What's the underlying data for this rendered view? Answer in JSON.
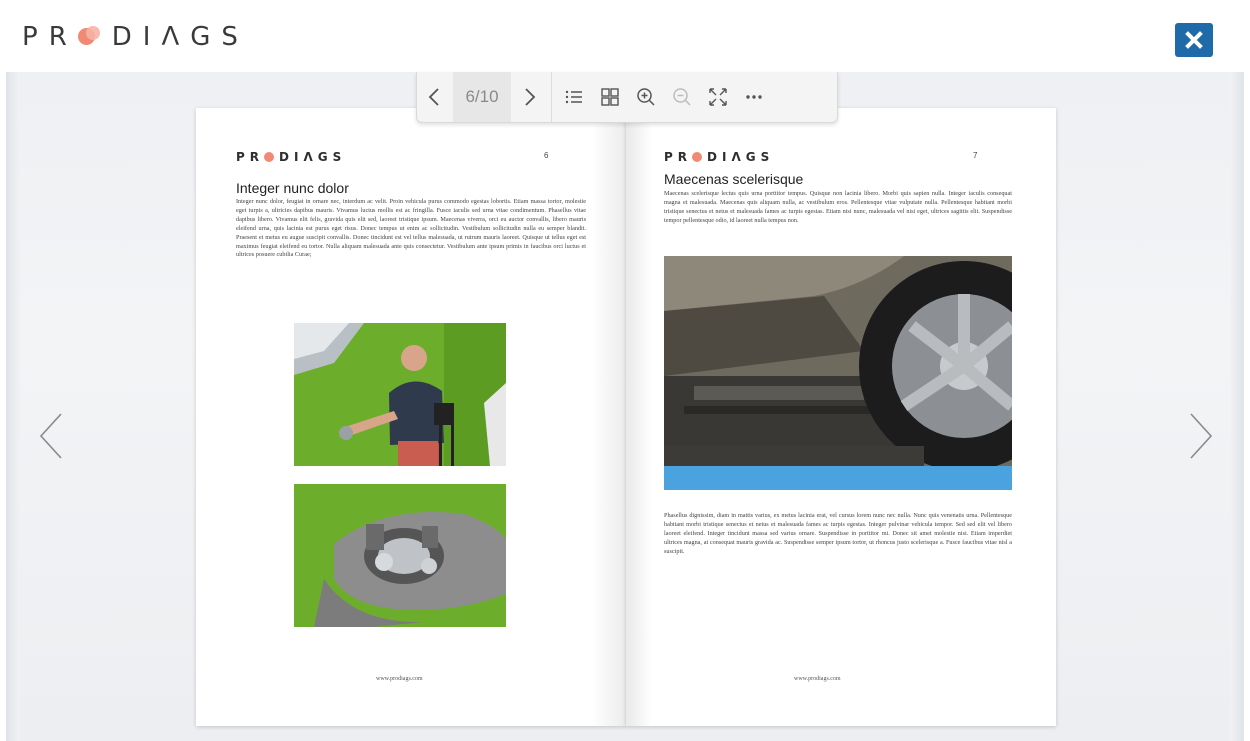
{
  "brand": {
    "logo_text": "PR DIAGS"
  },
  "toolbar": {
    "page_indicator": "6/10",
    "icons": [
      "chevron-left-icon",
      "chevron-right-icon",
      "list-icon",
      "grid-icon",
      "zoom-in-icon",
      "zoom-out-icon",
      "fullscreen-icon",
      "more-icon"
    ]
  },
  "colors": {
    "brand_blue": "#1f6aa8",
    "brand_coral": "#f08a74",
    "photo_green": "#6cae2b",
    "car_blue": "#4aa3df"
  },
  "left_page": {
    "logo": "PR DIAGS",
    "page_number": "6",
    "title": "Integer nunc dolor",
    "body": "Integer nunc dolor, feugiat in ornare nec, interdum ac velit. Proin vehicula purus commodo egestas lobortis. Etiam massa tortor, molestie eget turpis a, ultricies dapibus mauris. Vivamus luctus mollis est ac fringilla. Fusce iaculis sed urna vitae condimentum. Phasellus vitae dapibus libero. Vivamus elit felis, gravida quis elit sed, laoreet tristique ipsum. Maecenas viverra, orci eu auctor convallis, libero mauris eleifend urna, quis lacinia est purus eget risus. Donec tempus ut enim ac sollicitudin. Vestibulum sollicitudin nulla eu semper blandit. Praesent et metus eu augue suscipit convallis. Donec tincidunt est vel tellus malesuada, ut rutrum mauris laoreet. Quisque ut tellus eget est maximus feugiat eleifend eu tortor. Nulla aliquam malesuada ante quis consectetur. Vestibulum ante ipsum primis in faucibus orci luctus et ultrices posuere cubilia Curae;",
    "footer": "www.prodiags.com"
  },
  "right_page": {
    "logo": "PR DIAGS",
    "page_number": "7",
    "title": "Maecenas scelerisque",
    "body_top": "Maecenas scelerisque lectus quis urna porttitor tempus. Quisque non lacinia libero. Morbi quis sapien nulla. Integer iaculis consequat magna et malesuada. Maecenas quis aliquam nulla, ac vestibulum eros. Pellentesque vitae vulputate nulla. Pellentesque habitant morbi tristique senectus et netus et malesuada fames ac turpis egestas. Etiam nisi nunc, malesuada vel nisi eget, ultrices sagittis elit. Suspendisse tempor pellentesque odio, id laoreet nulla tempus non.",
    "body_bottom": "Phasellus dignissim, diam in mattis varius, ex metus lacinia erat, vel cursus lorem nunc nec nulla. Nunc quis venenatis urna. Pellentesque habitant morbi tristique senectus et netus et malesuada fames ac turpis egestas. Integer pulvinar vehicula tempor. Sed sed elit vel libero laoreet eleifend. Integer tincidunt massa sed varius ornare. Suspendisse in porttitor mi. Donec sit amet molestie nisi. Etiam imperdiet ultrices magna, at consequat mauris gravida ac. Suspendisse semper ipsum tortor, ut rhoncus justo scelerisque a. Fusce faucibus vitae nisl a suscipit.",
    "footer": "www.prodiags.com"
  }
}
